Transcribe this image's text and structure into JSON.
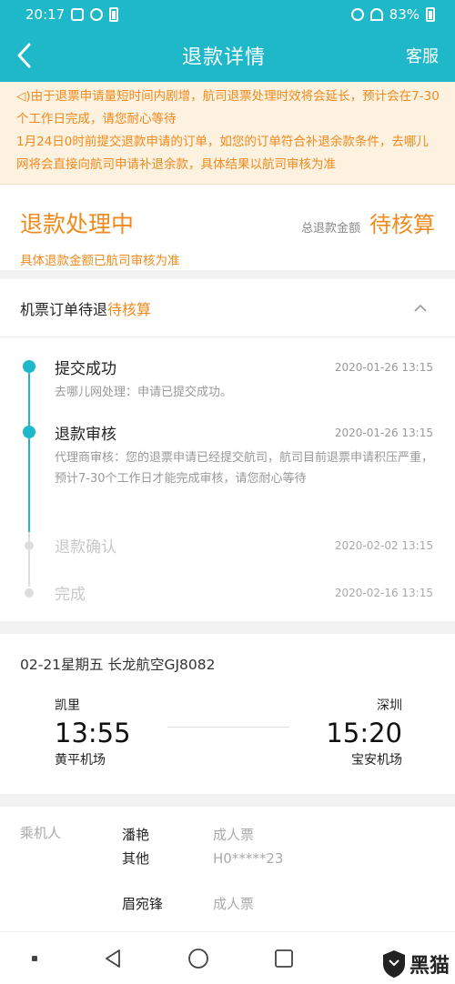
{
  "status_bar": {
    "time": "20:17",
    "battery": "83%"
  },
  "header": {
    "title": "退款详情",
    "action": "客服"
  },
  "notice": {
    "lines": [
      "由于退票申请量短时间内剧增，航司退票处理时效将会延长，预计会在7-30个工作日完成，请您耐心等待",
      "1月24日0时前提交退款申请的订单，如您的订单符合补退余款条件，去哪儿网将会直接向航司申请补退余款，具体结果以航司审核为准"
    ]
  },
  "summary": {
    "status": "退款处理中",
    "amount_label": "总退款金额",
    "amount_value": "待核算",
    "note": "具体退款金额已航司审核为准"
  },
  "progress": {
    "title": "机票订单待退",
    "title_tag": "待核算",
    "steps": [
      {
        "title": "提交成功",
        "time": "2020-01-26 13:15",
        "desc": "去哪儿网处理：申请已提交成功。",
        "state": "active"
      },
      {
        "title": "退款审核",
        "time": "2020-01-26 13:15",
        "desc": "代理商审核：您的退票申请已经提交航司，航司目前退票申请积压严重，预计7-30个工作日才能完成审核，请您耐心等待",
        "state": "active"
      },
      {
        "title": "退款确认",
        "time": "2020-02-02 13:15",
        "desc": "",
        "state": "idle"
      },
      {
        "title": "完成",
        "time": "2020-02-16 13:15",
        "desc": "",
        "state": "idle"
      }
    ]
  },
  "flight": {
    "summary": "02-21星期五 长龙航空GJ8082",
    "departure": {
      "city": "凯里",
      "time": "13:55",
      "airport": "黄平机场"
    },
    "arrival": {
      "city": "深圳",
      "time": "15:20",
      "airport": "宝安机场"
    }
  },
  "passengers": {
    "label": "乘机人",
    "list": [
      {
        "name": "潘艳",
        "type": "成人票"
      },
      {
        "name": "其他",
        "type": "H0*****23"
      },
      {
        "name": "眉宛锋",
        "type": "成人票"
      }
    ]
  },
  "watermark": {
    "text": "黑猫"
  },
  "colors": {
    "accent": "#1fb8c9",
    "orange": "#f08a1c"
  }
}
